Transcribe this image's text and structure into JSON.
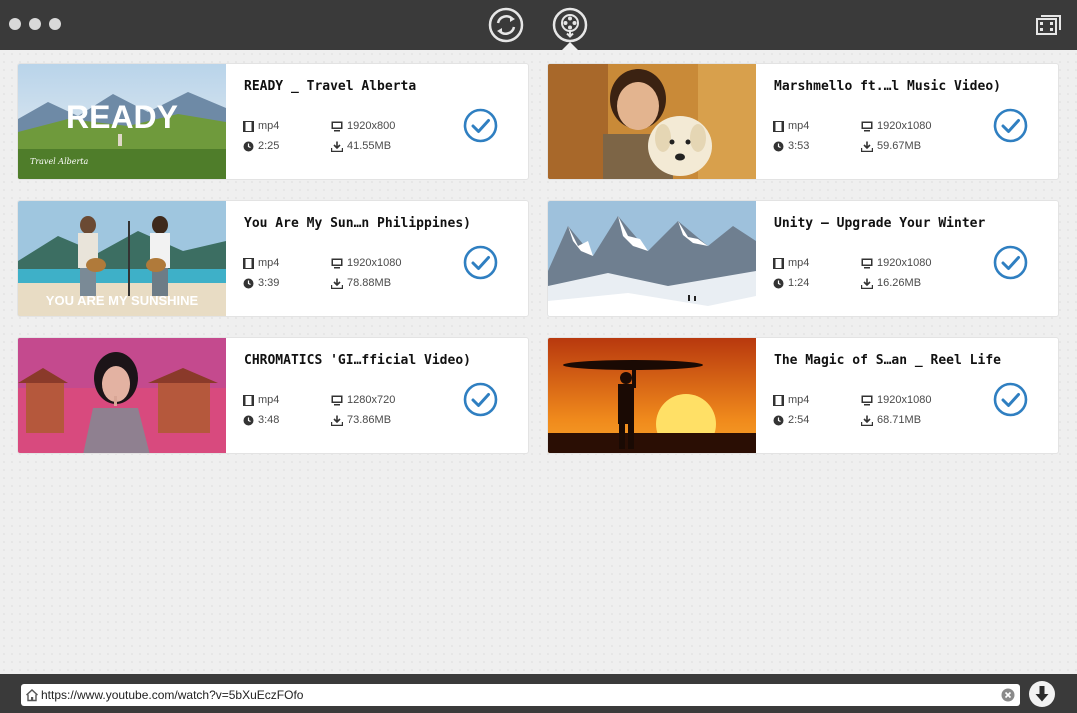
{
  "url_bar": {
    "value": "https://www.youtube.com/watch?v=5bXuEczFOfo"
  },
  "colors": {
    "accent": "#2f7fc1",
    "titlebar": "#3a3a3a",
    "background": "#efefef"
  },
  "icons": {
    "mode_refresh": "refresh-cycle-icon",
    "mode_download": "film-download-icon",
    "library": "film-library-icon",
    "format": "film-icon",
    "resolution": "monitor-icon",
    "duration": "clock-icon",
    "size": "download-icon",
    "done": "check-circle-icon",
    "home": "home-icon",
    "clear": "clear-icon",
    "download": "download-arrow-icon"
  },
  "videos": [
    {
      "title": "READY _ Travel Alberta",
      "format": "mp4",
      "resolution": "1920x800",
      "duration": "2:25",
      "size": "41.55MB",
      "thumb_text": "READY",
      "thumb_logo": "Travel Alberta"
    },
    {
      "title": "Marshmello ft.…l Music Video)",
      "format": "mp4",
      "resolution": "1920x1080",
      "duration": "3:53",
      "size": "59.67MB"
    },
    {
      "title": "You Are My Sun…n Philippines)",
      "format": "mp4",
      "resolution": "1920x1080",
      "duration": "3:39",
      "size": "78.88MB",
      "thumb_text": "YOU ARE MY SUNSHINE"
    },
    {
      "title": "Unity – Upgrade Your Winter",
      "format": "mp4",
      "resolution": "1920x1080",
      "duration": "1:24",
      "size": "16.26MB"
    },
    {
      "title": "CHROMATICS 'GI…fficial Video)",
      "format": "mp4",
      "resolution": "1280x720",
      "duration": "3:48",
      "size": "73.86MB"
    },
    {
      "title": "The Magic of S…an _ Reel Life",
      "format": "mp4",
      "resolution": "1920x1080",
      "duration": "2:54",
      "size": "68.71MB"
    }
  ]
}
